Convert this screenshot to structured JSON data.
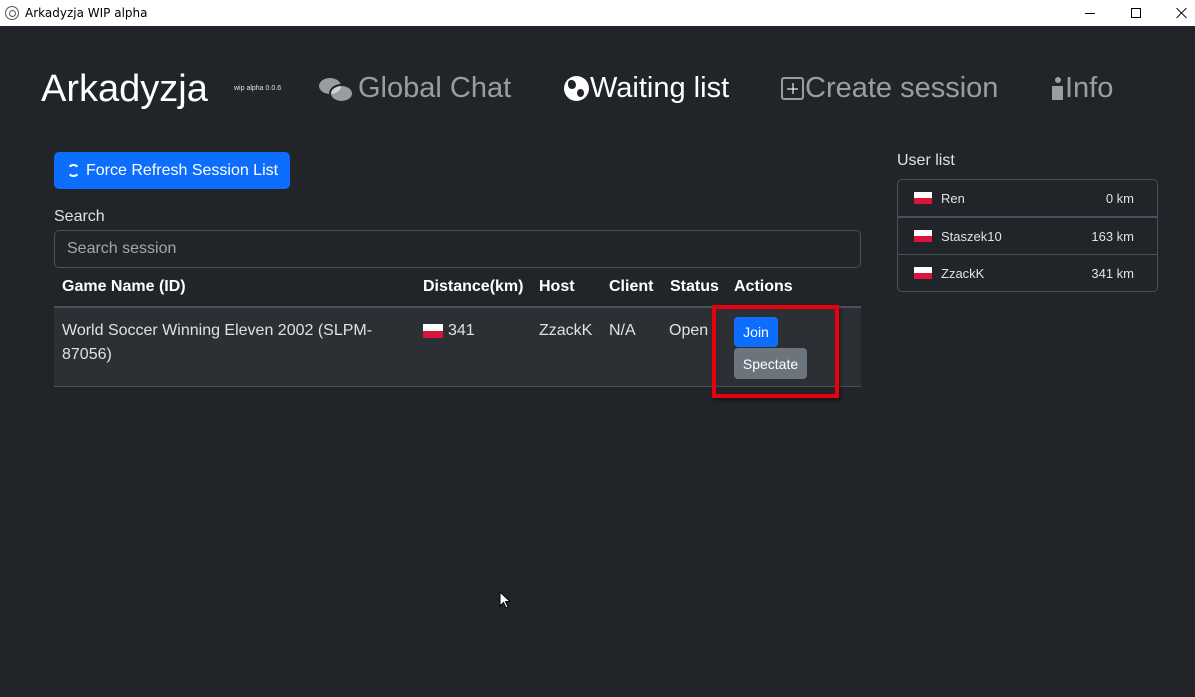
{
  "window": {
    "title": "Arkadyzja WIP alpha"
  },
  "header": {
    "brand": "Arkadyzja",
    "version": "wip alpha 0.0.6",
    "nav": [
      {
        "label": "Global Chat",
        "icon": "chat-icon",
        "active": false
      },
      {
        "label": "Waiting list",
        "icon": "globe-icon",
        "active": true
      },
      {
        "label": "Create session",
        "icon": "plus-square-icon",
        "active": false
      },
      {
        "label": "Info",
        "icon": "info-icon",
        "active": false
      }
    ]
  },
  "sessions": {
    "refresh_label": "Force Refresh Session List",
    "search_label": "Search",
    "search_placeholder": "Search session",
    "search_value": "",
    "columns": [
      "Game Name (ID)",
      "Distance(km)",
      "Host",
      "Client",
      "Status",
      "Actions"
    ],
    "rows": [
      {
        "game_name": "World Soccer Winning Eleven 2002 (SLPM-87056)",
        "distance": "341",
        "host": "ZzackK",
        "client": "N/A",
        "status": "Open",
        "join_label": "Join",
        "spectate_label": "Spectate"
      }
    ]
  },
  "user_list": {
    "title": "User list",
    "users": [
      {
        "name": "Ren",
        "distance": "0 km"
      },
      {
        "name": "Staszek10",
        "distance": "163 km"
      },
      {
        "name": "ZzackK",
        "distance": "341 km"
      }
    ]
  },
  "colors": {
    "background": "#212529",
    "primary": "#0d6efd",
    "secondary": "#6c757d",
    "highlight": "#e8000b"
  }
}
